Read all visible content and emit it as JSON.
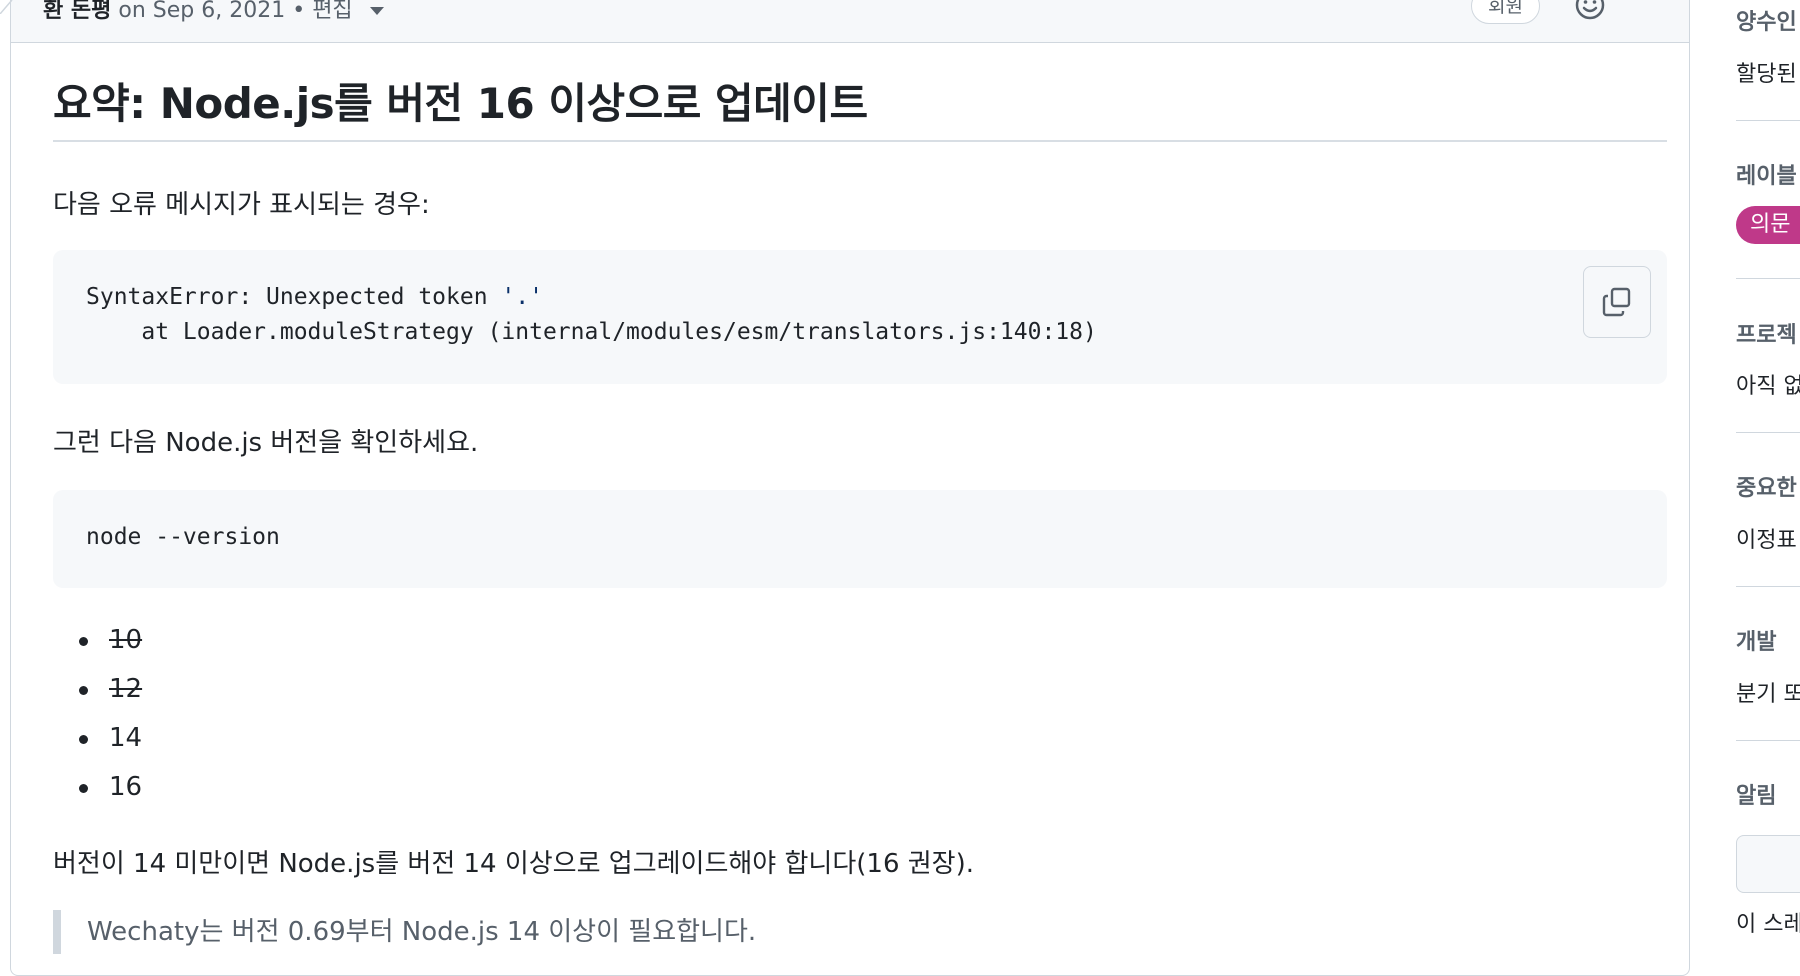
{
  "comment": {
    "author": "환 돈평",
    "date_text": "on Sep 6, 2021",
    "edited_label": "• 편집",
    "role_badge": "회원",
    "title": "요약: Node.js를 버전 16 이상으로 업데이트",
    "intro": "다음 오류 메시지가 표시되는 경우:",
    "error_code": {
      "line1_prefix": "SyntaxError: Unexpected token ",
      "line1_string": "'.'",
      "line2": "    at Loader.moduleStrategy (internal/modules/esm/translators.js:140:18)"
    },
    "check_text": "그런 다음 Node.js 버전을 확인하세요.",
    "version_cmd": "node --version",
    "versions": [
      {
        "label": "10",
        "struck": true
      },
      {
        "label": "12",
        "struck": true
      },
      {
        "label": "14",
        "struck": false
      },
      {
        "label": "16",
        "struck": false
      }
    ],
    "upgrade_text": "버전이 14 미만이면 Node.js를 버전 14 이상으로 업그레이드해야 합니다(16 권장).",
    "quote_text": "Wechaty는 버전 0.69부터 Node.js 14 이상이 필요합니다."
  },
  "sidebar": {
    "assignees_heading": "양수인",
    "assignees_value": "할당된",
    "labels_heading": "레이블",
    "label_question": "의문",
    "projects_heading": "프로젝",
    "projects_value": "아직 없",
    "milestone_heading": "중요한",
    "milestone_value": "이정표",
    "development_heading": "개발",
    "development_value": "분기 또",
    "notifications_heading": "알림",
    "notifications_footer": "이 스레"
  },
  "colors": {
    "label_question": "#bf3989",
    "border": "#d0d7de",
    "code_bg": "#f6f8fa"
  }
}
